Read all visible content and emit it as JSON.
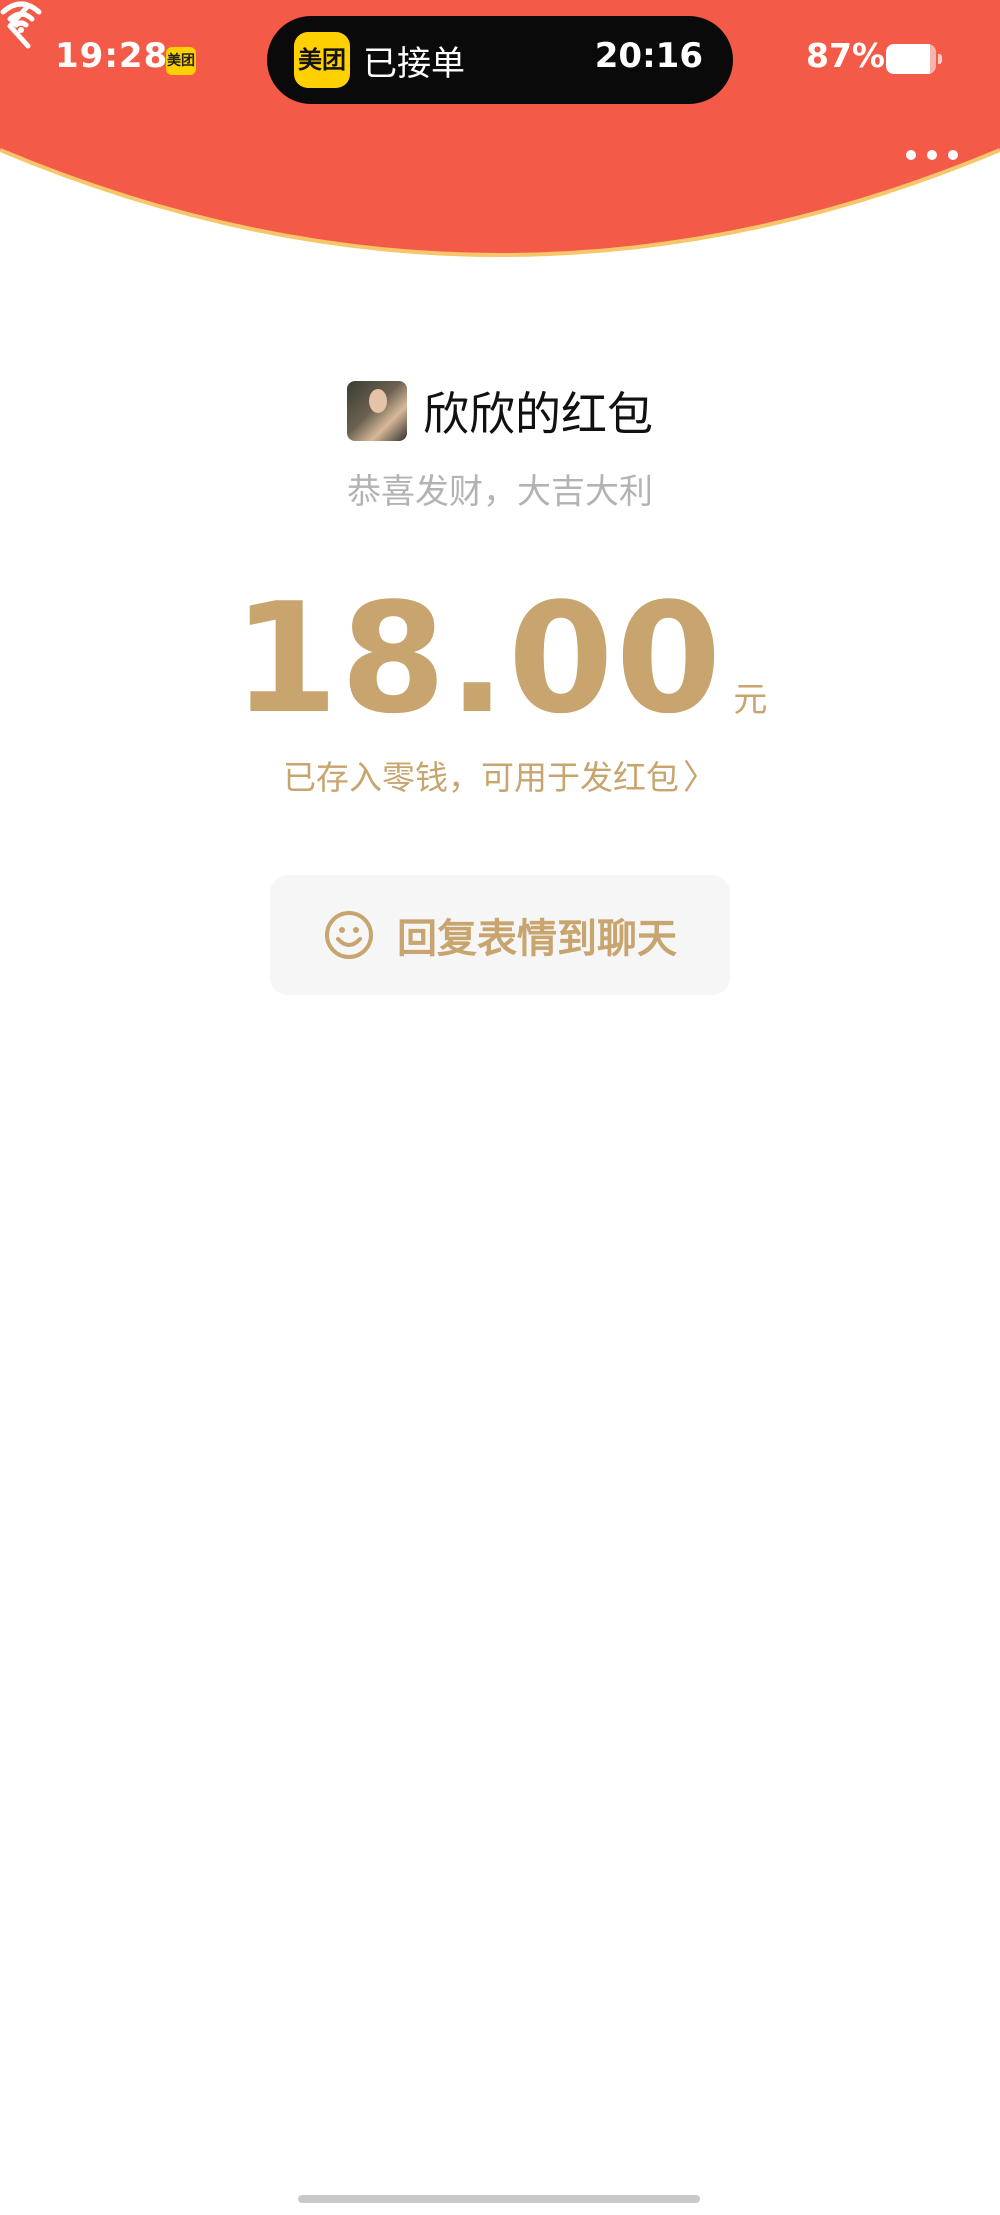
{
  "status_bar": {
    "time": "19:28",
    "app_badge": "美团",
    "island": {
      "app_logo": "美团",
      "status": "已接单",
      "time": "20:16"
    },
    "battery_text": "87%",
    "battery_level": 0.87
  },
  "nav": {
    "back_icon": "chevron-left-icon",
    "more_icon": "more-horizontal-icon"
  },
  "envelope": {
    "sender": "欣欣的红包",
    "blessing": "恭喜发财，大吉大利",
    "amount": "18.00",
    "unit": "元",
    "deposit_note": "已存入零钱，可用于发红包",
    "deposit_chevron": "〉",
    "reply_button": "回复表情到聊天"
  },
  "colors": {
    "header_red": "#f45a48",
    "gold": "#c8a46e",
    "header_rim": "#f7c56a"
  }
}
